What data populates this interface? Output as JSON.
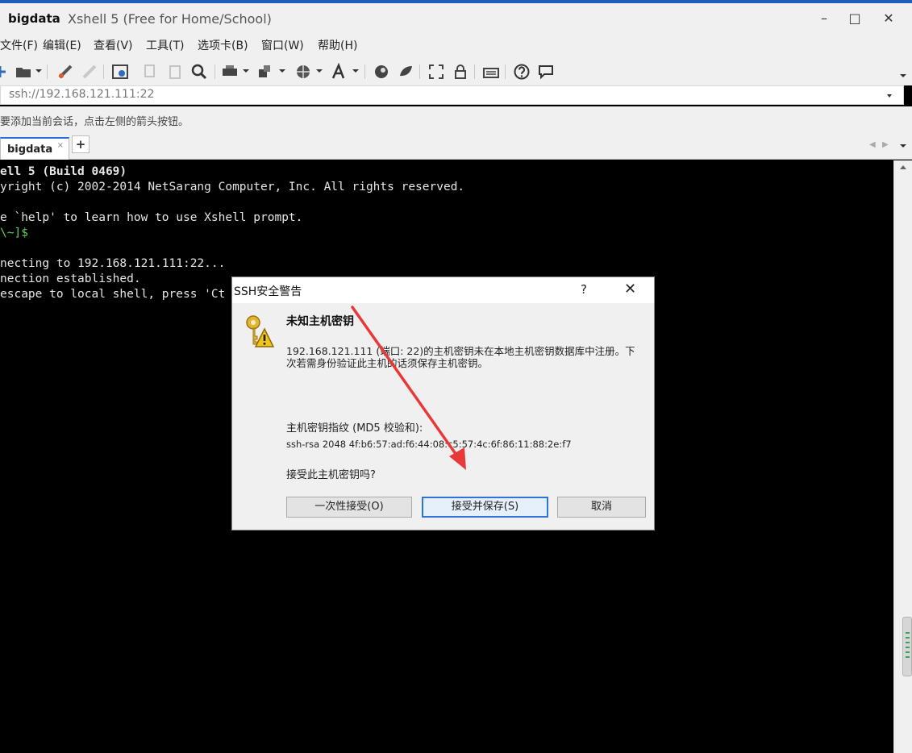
{
  "window": {
    "app_name": "bigdata",
    "subtitle": "Xshell 5 (Free for Home/School)",
    "minimize_glyph": "–",
    "maximize_glyph": "□",
    "close_glyph": "✕"
  },
  "menu": {
    "items": [
      "文件(F)",
      "编辑(E)",
      "查看(V)",
      "工具(T)",
      "选项卡(B)",
      "窗口(W)",
      "帮助(H)"
    ]
  },
  "toolbar": {
    "icons": [
      "new-session-icon",
      "open-folder-icon",
      "connect-icon",
      "disconnect-icon",
      "properties-icon",
      "copy-icon",
      "paste-icon",
      "find-icon",
      "print-icon",
      "transfer-icon",
      "globe-icon",
      "font-icon",
      "xftp-icon",
      "xagent-icon",
      "fullscreen-icon",
      "lock-icon",
      "keyboard-icon",
      "help-icon",
      "chat-icon"
    ]
  },
  "address": {
    "value": "ssh://192.168.121.111:22"
  },
  "hint": {
    "text": "要添加当前会话，点击左侧的箭头按钮。"
  },
  "tabs": {
    "active_label": "bigdata",
    "close_glyph": "×",
    "add_glyph": "+"
  },
  "terminal": {
    "lines": [
      "ell 5 (Build 0469)",
      "yright (c) 2002-2014 NetSarang Computer, Inc. All rights reserved.",
      "e `help' to learn how to use Xshell prompt.",
      "\\~]$",
      "necting to 192.168.121.111:22...",
      "nection established.",
      "escape to local shell, press 'Ct"
    ]
  },
  "dialog": {
    "title": "SSH安全警告",
    "help_glyph": "?",
    "close_glyph": "✕",
    "heading": "未知主机密钥",
    "message": "192.168.121.111 (端口: 22)的主机密钥未在本地主机密钥数据库中注册。下次若需身份验证此主机的话须保存主机密钥。",
    "fingerprint_label": "主机密钥指纹 (MD5 校验和):",
    "fingerprint_value": "ssh-rsa 2048 4f:b6:57:ad:f6:44:08:c5:57:4c:6f:86:11:88:2e:f7",
    "question": "接受此主机密钥吗?",
    "buttons": {
      "accept_once": "一次性接受(O)",
      "accept_save": "接受并保存(S)",
      "cancel": "取消"
    }
  },
  "colors": {
    "title_accent": "#1e5db8",
    "terminal_bg": "#000000",
    "terminal_fg": "#e6e6e6",
    "prompt_green": "#5fd35f",
    "primary_button_border": "#2f73d8",
    "annotation_arrow": "#e8393a"
  }
}
